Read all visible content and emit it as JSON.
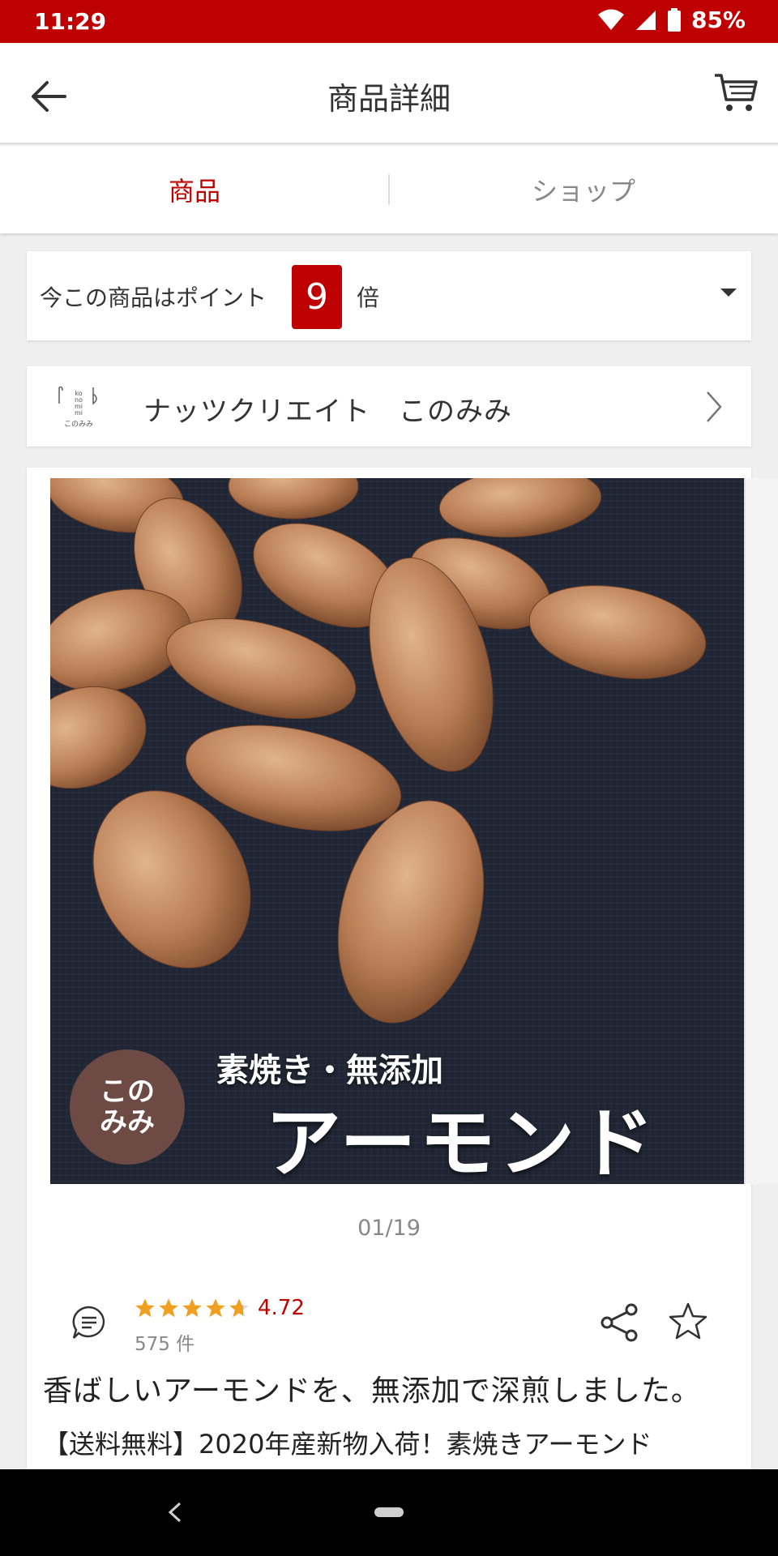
{
  "status_bar": {
    "time": "11:29",
    "battery": "85%"
  },
  "header": {
    "title": "商品詳細"
  },
  "tabs": [
    {
      "label": "商品"
    },
    {
      "label": "ショップ"
    }
  ],
  "points": {
    "prefix": "今この商品はポイント",
    "multiplier": "9",
    "suffix": "倍"
  },
  "shop": {
    "name": "ナッツクリエイト　このみみ"
  },
  "hero": {
    "badge_line1": "この",
    "badge_line2": "みみ",
    "subtitle": "素焼き・無添加",
    "title": "アーモンド"
  },
  "pager": "01/19",
  "review": {
    "rating": "4.72",
    "rating_value": 4.72,
    "count": "575 件"
  },
  "product": {
    "catch_copy": "香ばしいアーモンドを、無添加で深煎しました。",
    "name": "【送料無料】2020年産新物入荷！素焼きアーモンド"
  },
  "colors": {
    "brand": "#bf0000",
    "star": "#f0a020"
  }
}
